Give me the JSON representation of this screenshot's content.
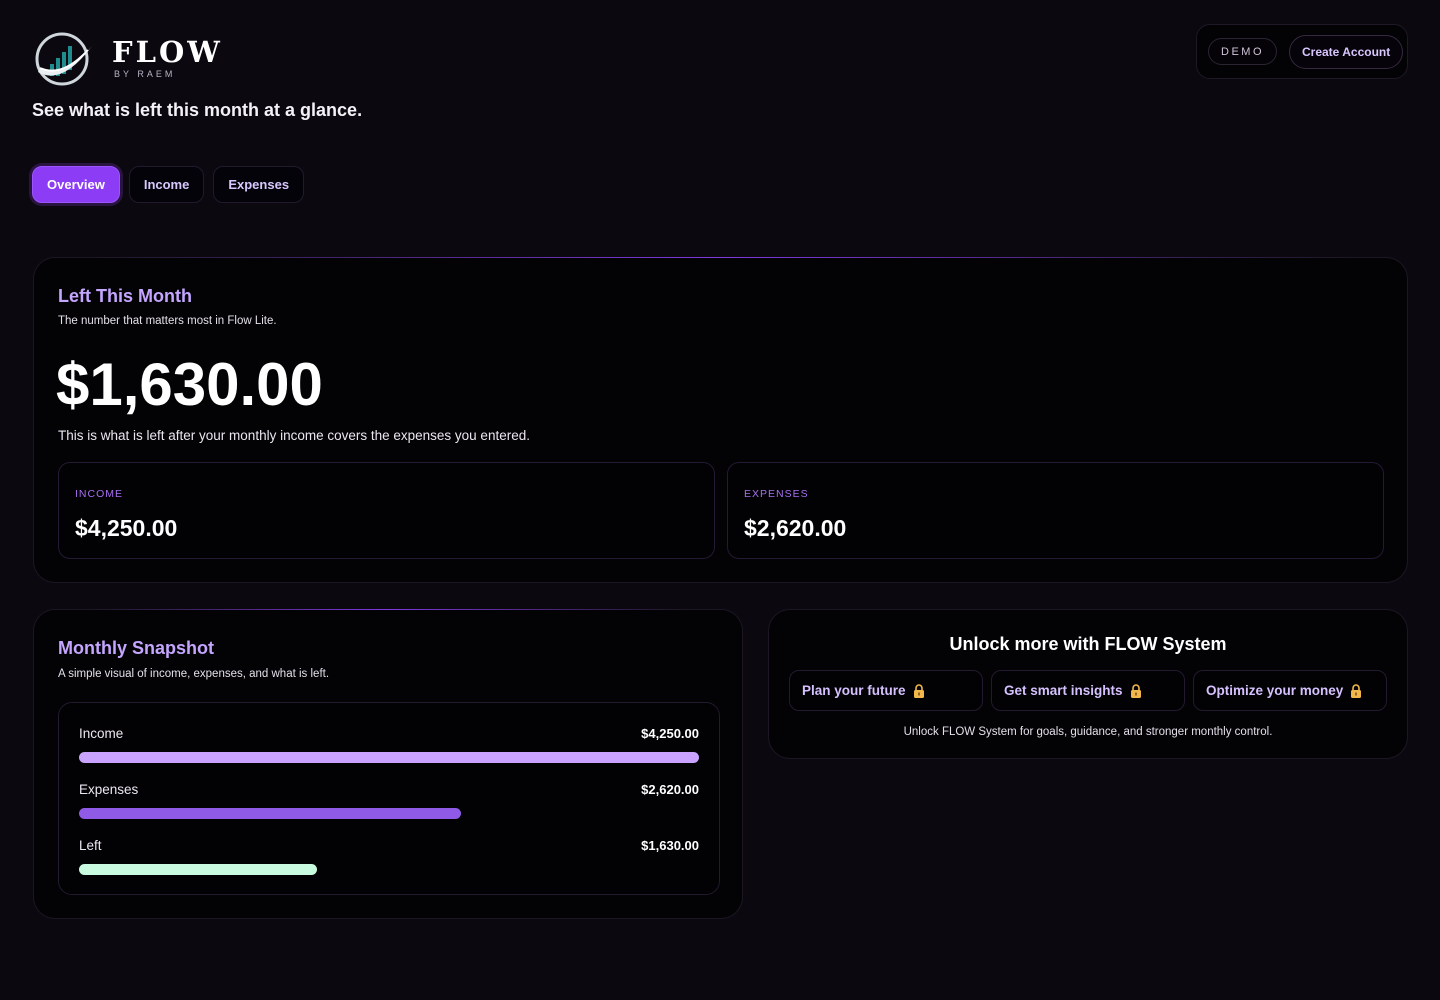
{
  "brand": {
    "name": "FLOW",
    "sub": "BY RAEM"
  },
  "tagline": "See what is left this month at a glance.",
  "top_actions": {
    "demo_label": "DEMO",
    "create_label": "Create Account"
  },
  "tabs": [
    {
      "label": "Overview",
      "active": true
    },
    {
      "label": "Income",
      "active": false
    },
    {
      "label": "Expenses",
      "active": false
    }
  ],
  "hero": {
    "title": "Left This Month",
    "subtitle": "The number that matters most in Flow Lite.",
    "amount": "$1,630.00",
    "description": "This is what is left after your monthly income covers the expenses you entered.",
    "income_label": "INCOME",
    "income_value": "$4,250.00",
    "expenses_label": "EXPENSES",
    "expenses_value": "$2,620.00"
  },
  "snapshot": {
    "title": "Monthly Snapshot",
    "subtitle": "A simple visual of income, expenses, and what is left.",
    "bars": [
      {
        "name": "Income",
        "value": "$4,250.00",
        "fraction": 1.0,
        "color": "#c9a3ff"
      },
      {
        "name": "Expenses",
        "value": "$2,620.00",
        "fraction": 0.616,
        "color": "#8f5ae6"
      },
      {
        "name": "Left",
        "value": "$1,630.00",
        "fraction": 0.384,
        "color": "#c8fbe0"
      }
    ]
  },
  "unlock": {
    "title": "Unlock more with FLOW System",
    "chips": [
      {
        "label": "Plan your future"
      },
      {
        "label": "Get smart insights"
      },
      {
        "label": "Optimize your money"
      }
    ],
    "note": "Unlock FLOW System for goals, guidance, and stronger monthly control."
  },
  "colors": {
    "accent": "#8d3cf5",
    "accent_text": "#c5a6ff",
    "lock": "#f2b84b"
  },
  "icons": {
    "logo": "flow-logo-icon",
    "lock": "lock-icon"
  }
}
